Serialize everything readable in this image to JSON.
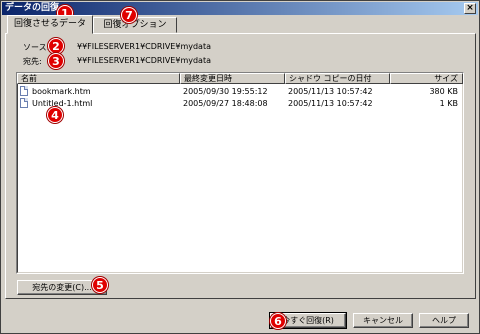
{
  "window": {
    "title": "データの回復",
    "close_glyph": "×"
  },
  "tabs": [
    {
      "label": "回復させるデータ"
    },
    {
      "label": "回復オプション"
    }
  ],
  "source": {
    "label": "ソース:",
    "value": "¥¥FILESERVER1¥CDRIVE¥mydata"
  },
  "destination": {
    "label": "宛先:",
    "value": "¥¥FILESERVER1¥CDRIVE¥mydata"
  },
  "file_list": {
    "columns": [
      "名前",
      "最終変更日時",
      "シャドウ コピーの日付",
      "サイズ"
    ],
    "rows": [
      {
        "name": "bookmark.htm",
        "modified": "2005/09/30 19:55:12",
        "shadow_date": "2005/11/13 10:57:42",
        "size": "380 KB"
      },
      {
        "name": "Untitled-1.html",
        "modified": "2005/09/27 18:48:08",
        "shadow_date": "2005/11/13 10:57:42",
        "size": "1 KB"
      }
    ]
  },
  "buttons": {
    "change_destination": "宛先の変更(C)...",
    "restore_now": "今すぐ回復(R)",
    "cancel": "キャンセル",
    "help": "ヘルプ"
  },
  "badges": [
    "1",
    "2",
    "3",
    "4",
    "5",
    "6",
    "7"
  ],
  "colors": {
    "badge": "#e00000",
    "titlebar": "#0a246a"
  }
}
